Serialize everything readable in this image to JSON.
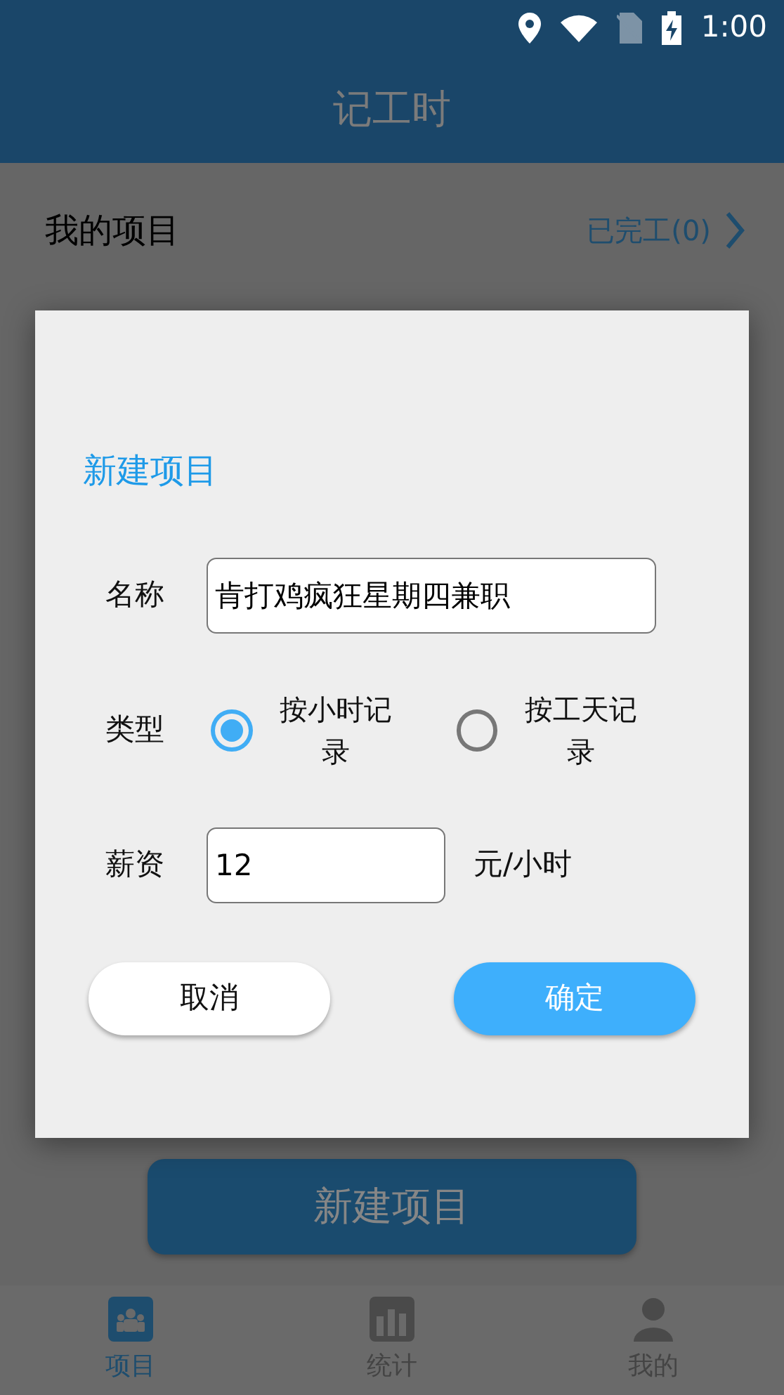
{
  "status_bar": {
    "time": "1:00"
  },
  "app_bar": {
    "title": "记工时"
  },
  "section": {
    "title": "我的项目",
    "completed_link": "已完工(0)"
  },
  "dialog": {
    "title": "新建项目",
    "fields": [
      {
        "kind": "text",
        "label": "名称",
        "value": "肯打鸡疯狂星期四兼职"
      },
      {
        "kind": "radio",
        "label": "类型",
        "options": [
          {
            "label": "按小时记录",
            "selected": true
          },
          {
            "label": "按工天记录",
            "selected": false
          }
        ]
      },
      {
        "kind": "number",
        "label": "薪资",
        "value": "12",
        "unit": "元/小时"
      }
    ],
    "buttons": [
      {
        "label": "取消",
        "kind": "secondary"
      },
      {
        "label": "确定",
        "kind": "primary"
      }
    ]
  },
  "new_project_button": "新建项目",
  "bottom_nav": [
    {
      "label": "项目",
      "selected": true
    },
    {
      "label": "统计",
      "selected": false
    },
    {
      "label": "我的",
      "selected": false
    }
  ]
}
